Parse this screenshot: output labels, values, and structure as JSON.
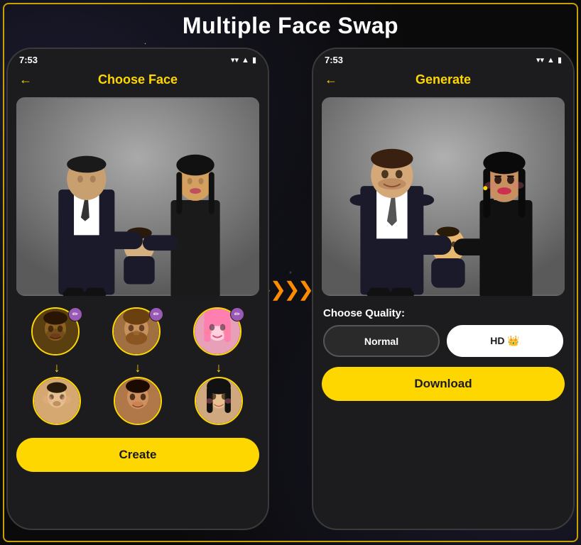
{
  "page": {
    "title": "Multiple Face Swap",
    "background_color": "#0a0a0a",
    "gold_border": "#c8a000"
  },
  "left_phone": {
    "status_bar": {
      "time": "7:53",
      "icons": [
        "signal",
        "wifi",
        "battery"
      ]
    },
    "header": {
      "back_label": "←",
      "title": "Choose Face"
    },
    "main_image_alt": "Family portrait - man in suit, woman in black dress, baby",
    "face_pairs": [
      {
        "source_face": "Male face 1 - dark skin",
        "target_face": "Baby face",
        "edit_icon": "✏"
      },
      {
        "source_face": "Male face 2 - beard",
        "target_face": "Young male face",
        "edit_icon": "✏"
      },
      {
        "source_face": "Female face - pink hair",
        "target_face": "Young female face",
        "edit_icon": "✏"
      }
    ],
    "create_button": {
      "label": "Create"
    }
  },
  "arrow_between": {
    "symbol": "❯❯❯❯❯",
    "color": "#ff8c00"
  },
  "right_phone": {
    "status_bar": {
      "time": "7:53",
      "icons": [
        "signal",
        "wifi",
        "battery"
      ]
    },
    "header": {
      "back_label": "←",
      "title": "Generate"
    },
    "main_image_alt": "Swapped family portrait with new faces",
    "quality_section": {
      "label": "Choose Quality:",
      "options": [
        {
          "id": "normal",
          "label": "Normal",
          "selected": false
        },
        {
          "id": "hd",
          "label": "HD 👑",
          "selected": true
        }
      ]
    },
    "download_button": {
      "label": "Download"
    }
  }
}
